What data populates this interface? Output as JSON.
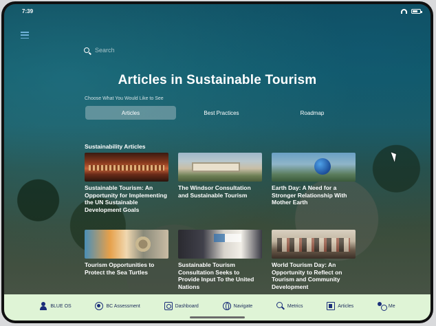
{
  "status": {
    "time": "7:39"
  },
  "search": {
    "placeholder": "Search"
  },
  "page": {
    "title": "Articles in Sustainable Tourism",
    "subtitle": "Choose What You Would Like to See",
    "section_title": "Sustainability Articles"
  },
  "tabs": [
    {
      "label": "Articles",
      "active": true
    },
    {
      "label": "Best Practices",
      "active": false
    },
    {
      "label": "Roadmap",
      "active": false
    }
  ],
  "articles": [
    {
      "title": "Sustainable Tourism: An Opportunity for Implementing the UN Sustainable Development Goals"
    },
    {
      "title": "The Windsor Consultation and Sustainable Tourism"
    },
    {
      "title": "Earth Day: A Need for a Stronger Relationship With Mother Earth"
    },
    {
      "title": "Tourism Opportunities to Protect the Sea Turtles"
    },
    {
      "title": "Sustainable Tourism Consultation Seeks to Provide Input To the United Nations"
    },
    {
      "title": "World Tourism Day: An Opportunity to Reflect on Tourism and Community Development"
    }
  ],
  "tabbar": [
    {
      "label": "BLUE OS",
      "icon": "person-icon"
    },
    {
      "label": "BC Assessment",
      "icon": "certificate-icon"
    },
    {
      "label": "Dashboard",
      "icon": "dashboard-icon"
    },
    {
      "label": "Navigate",
      "icon": "globe-icon"
    },
    {
      "label": "Metrics",
      "icon": "metrics-icon"
    },
    {
      "label": "Articles",
      "icon": "articles-icon"
    },
    {
      "label": "Me",
      "icon": "me-icon"
    }
  ],
  "colors": {
    "tabbar_bg": "#dff4d6",
    "tabbar_text": "#1a2a5a",
    "menu_icon": "#6fb1d8"
  }
}
